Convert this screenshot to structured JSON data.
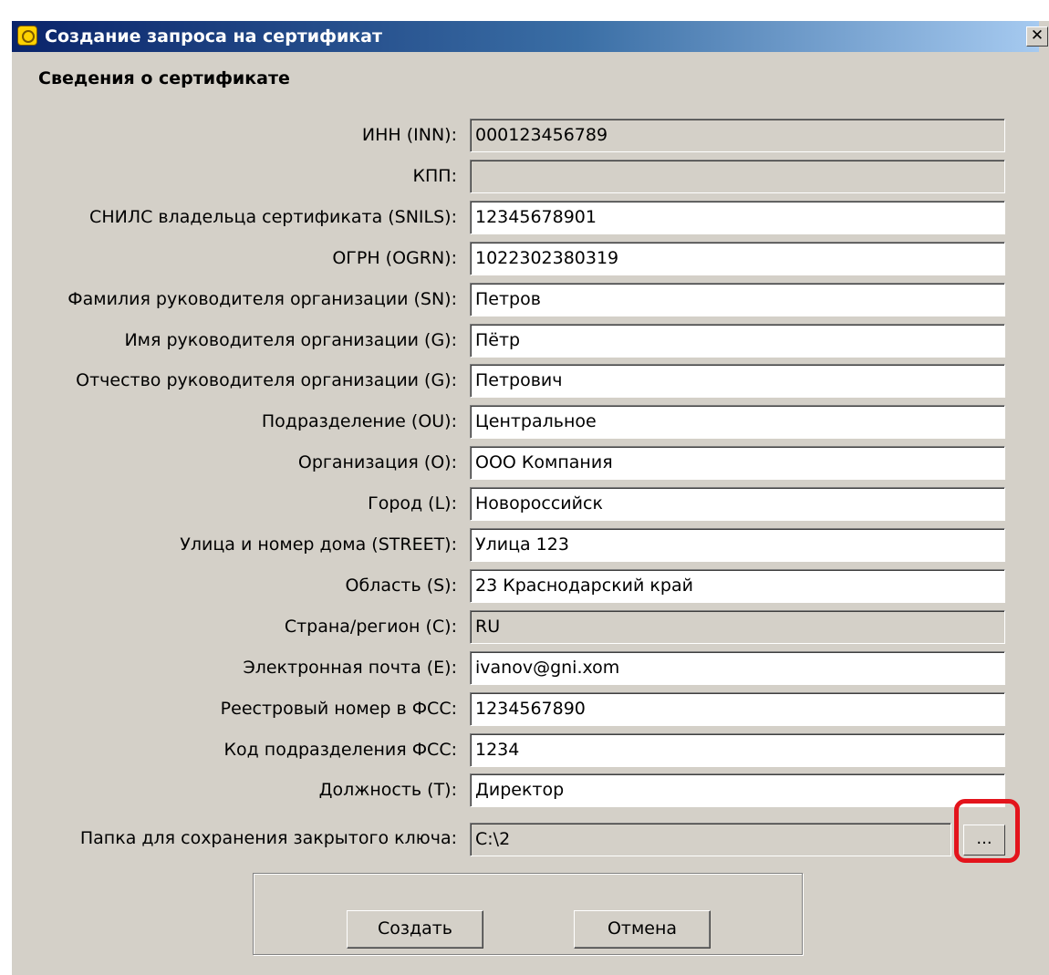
{
  "window": {
    "title": "Создание запроса на сертификат",
    "close_label": "✕"
  },
  "section_heading": "Сведения о сертификате",
  "fields": [
    {
      "label": "ИНН (INN):",
      "value": "000123456789",
      "readonly": true
    },
    {
      "label": "КПП:",
      "value": "",
      "readonly": true
    },
    {
      "label": "СНИЛС владельца сертификата (SNILS):",
      "value": "12345678901",
      "readonly": false
    },
    {
      "label": "ОГРН (OGRN):",
      "value": "1022302380319",
      "readonly": false
    },
    {
      "label": "Фамилия руководителя организации (SN):",
      "value": "Петров",
      "readonly": false
    },
    {
      "label": "Имя руководителя организации (G):",
      "value": "Пётр",
      "readonly": false
    },
    {
      "label": "Отчество руководителя организации (G):",
      "value": "Петрович",
      "readonly": false
    },
    {
      "label": "Подразделение (OU):",
      "value": "Центральное",
      "readonly": false
    },
    {
      "label": "Организация (O):",
      "value": "ООО Компания",
      "readonly": false
    },
    {
      "label": "Город (L):",
      "value": "Новороссийск",
      "readonly": false
    },
    {
      "label": "Улица и номер дома (STREET):",
      "value": "Улица 123",
      "readonly": false
    },
    {
      "label": "Область (S):",
      "value": "23 Краснодарский край",
      "readonly": false
    },
    {
      "label": "Страна/регион (C):",
      "value": "RU",
      "readonly": true
    },
    {
      "label": "Электронная почта (E):",
      "value": "ivanov@gni.xom",
      "readonly": false
    },
    {
      "label": "Реестровый номер в ФСС:",
      "value": "1234567890",
      "readonly": false
    },
    {
      "label": "Код подразделения ФСС:",
      "value": "1234",
      "readonly": false
    },
    {
      "label": "Должность (T):",
      "value": "Директор",
      "readonly": false
    }
  ],
  "key_folder": {
    "label": "Папка для сохранения закрытого ключа:",
    "value": "C:\\2",
    "browse_label": "..."
  },
  "buttons": {
    "create": "Создать",
    "cancel": "Отмена"
  },
  "colors": {
    "titlebar_start": "#0a246a",
    "titlebar_end": "#a6caf0",
    "dialog_face": "#d4d0c8",
    "highlight_ring": "#e3141c"
  }
}
